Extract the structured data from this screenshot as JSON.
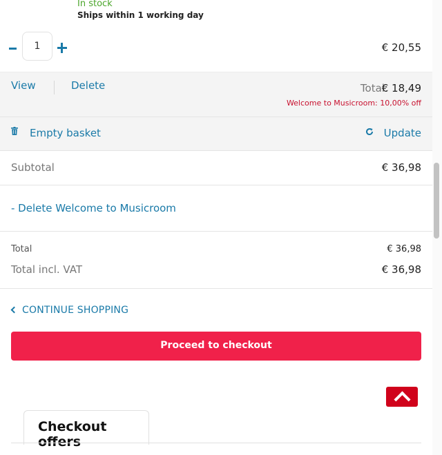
{
  "product": {
    "stock_status": "In stock",
    "shipping": "Ships within 1 working day",
    "quantity": "1",
    "line_price": "€ 20,55"
  },
  "item_actions": {
    "view_label": "View",
    "delete_label": "Delete",
    "total_label": "Total:",
    "total_value": "€ 18,49",
    "discount_note": "Welcome to Musicroom: 10,00% off"
  },
  "basket_actions": {
    "empty_label": "Empty basket",
    "update_label": "Update"
  },
  "summary": {
    "subtotal_label": "Subtotal",
    "subtotal_value": "€ 36,98",
    "coupon_link": "- Delete Welcome to Musicroom",
    "total_label": "Total",
    "total_value": "€ 36,98",
    "vat_label": "Total incl. VAT",
    "vat_value": "€ 36,98"
  },
  "navigation": {
    "continue_label": "CONTINUE SHOPPING",
    "checkout_label": "Proceed to checkout"
  },
  "offers": {
    "tab_title": "Checkout offers"
  },
  "icons": {
    "trash": "trash-icon",
    "refresh": "refresh-icon",
    "chevron_left": "chevron-left-icon",
    "scroll_top": "chevron-up-icon"
  },
  "colors": {
    "link": "#1a7aa8",
    "checkout_button": "#f0214a",
    "scroll_top_button": "#d0021b",
    "in_stock": "#4aa52a",
    "discount": "#c8102e"
  }
}
